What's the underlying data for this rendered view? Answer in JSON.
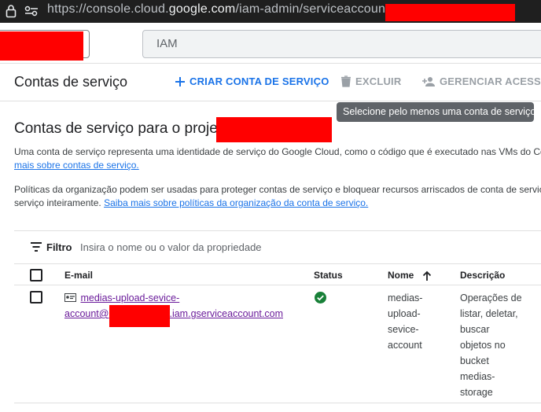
{
  "browser": {
    "url_prefix": "https://console.cloud.",
    "url_domain": "google.com",
    "url_path": "/iam-admin/serviceaccounts"
  },
  "topbar": {
    "search_value": "IAM"
  },
  "header": {
    "title": "Contas de serviço",
    "create_label": "CRIAR CONTA DE SERVIÇO",
    "delete_label": "EXCLUIR",
    "manage_label": "GERENCIAR ACESSO",
    "tooltip": "Selecione pelo menos uma conta de serviço"
  },
  "content": {
    "heading": "Contas de serviço para o projeto",
    "para1_line1": "Uma conta de serviço representa uma identidade de serviço do Google Cloud, como o código que é executado nas VMs do Co",
    "para1_link": "mais sobre contas de serviço.",
    "para2_line1": "Políticas da organização podem ser usadas para proteger contas de serviço e bloquear recursos arriscados de conta de serviç",
    "para2_line2": "serviço inteiramente.",
    "para2_link": "Saiba mais sobre políticas da organização da conta de serviço."
  },
  "filter": {
    "label": "Filtro",
    "placeholder": "Insira o nome ou o valor da propriedade"
  },
  "table": {
    "columns": {
      "email": "E-mail",
      "status": "Status",
      "name": "Nome",
      "description": "Descrição"
    },
    "rows": [
      {
        "email_line1": "medias-upload-sevice-",
        "email_line2_prefix": "account@",
        "email_line2_suffix": ".iam.gserviceaccount.com",
        "status": "enabled",
        "name_lines": [
          "medias-",
          "upload-",
          "sevice-",
          "account"
        ],
        "description_lines": [
          "Operações de",
          "listar, deletar,",
          "buscar",
          "objetos no",
          "bucket",
          "medias-",
          "storage"
        ]
      }
    ]
  },
  "colors": {
    "accent": "#1a73e8",
    "link_visited": "#6a1b9a",
    "status_ok": "#188038",
    "redaction": "#ff0000"
  }
}
